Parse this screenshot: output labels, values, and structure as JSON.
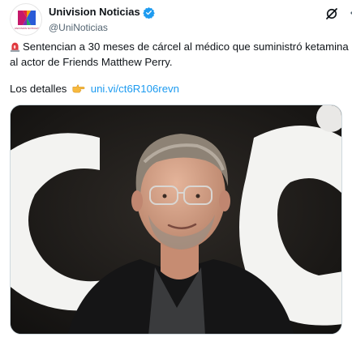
{
  "tweet": {
    "display_name": "Univision Noticias",
    "handle": "@UniNoticias",
    "body": "Sentencian a 30 meses de cárcel al médico que suministró ketamina al actor de Friends Matthew Perry.",
    "details_label": "Los detalles",
    "link_text": "univi/ct6R106revn",
    "link_text_display": "uni.vi/ct6R106revn"
  },
  "avatar": {
    "caption": "UNIVISION NOTICIAS"
  },
  "icons": {
    "verified": "verified-badge-icon",
    "grok": "grok-icon",
    "more": "more-options-icon",
    "siren": "police-light-emoji",
    "hand": "pointing-right-emoji"
  },
  "media": {
    "alt": "photo"
  },
  "colors": {
    "link": "#1d9bf0",
    "verified": "#1d9bf0",
    "logo_magenta": "#c5186a",
    "logo_red": "#e4253c",
    "logo_blue": "#2a5bd7",
    "logo_green": "#1fa85f"
  }
}
